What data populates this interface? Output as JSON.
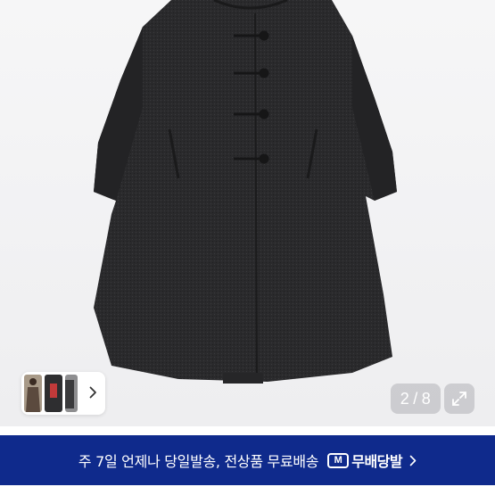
{
  "viewer": {
    "image_icon": "coat-product-photo",
    "page_current": "2",
    "page_separator": "/",
    "page_total": "8",
    "expand_icon": "expand-arrows-icon",
    "thumbnails_next_icon": "chevron-right-icon"
  },
  "banner": {
    "text": "주 7일 언제나 당일발송, 전상품 무료배송",
    "badge_logo": "M",
    "badge_text": "무배당발",
    "background_color": "#0f2a8c"
  }
}
